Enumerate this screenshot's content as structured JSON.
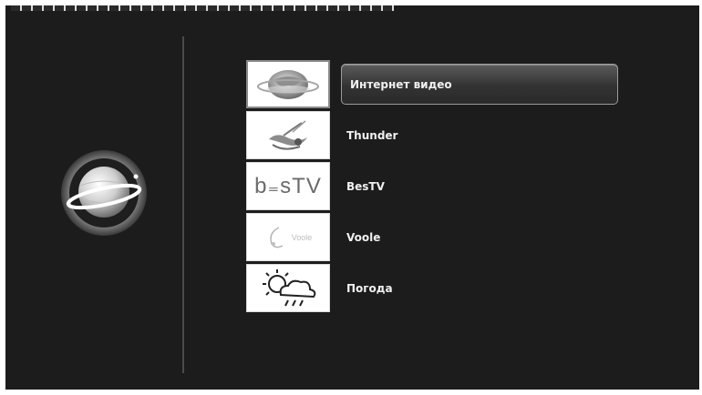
{
  "menu": {
    "items": [
      {
        "label": "Интернет видео",
        "icon": "internet-globe-icon",
        "selected": true
      },
      {
        "label": "Thunder",
        "icon": "thunder-logo-icon",
        "selected": false
      },
      {
        "label": "BesTV",
        "icon": "bestv-logo-icon",
        "thumb_text": "b₌sTV",
        "selected": false
      },
      {
        "label": "Voole",
        "icon": "voole-logo-icon",
        "thumb_text": "Voole",
        "selected": false
      },
      {
        "label": "Погода",
        "icon": "weather-icon",
        "selected": false
      }
    ]
  },
  "sidebar": {
    "icon": "globe-planet-icon"
  },
  "colors": {
    "background": "#1c1c1c",
    "highlight": "#444444",
    "text": "#f0f0f0"
  }
}
